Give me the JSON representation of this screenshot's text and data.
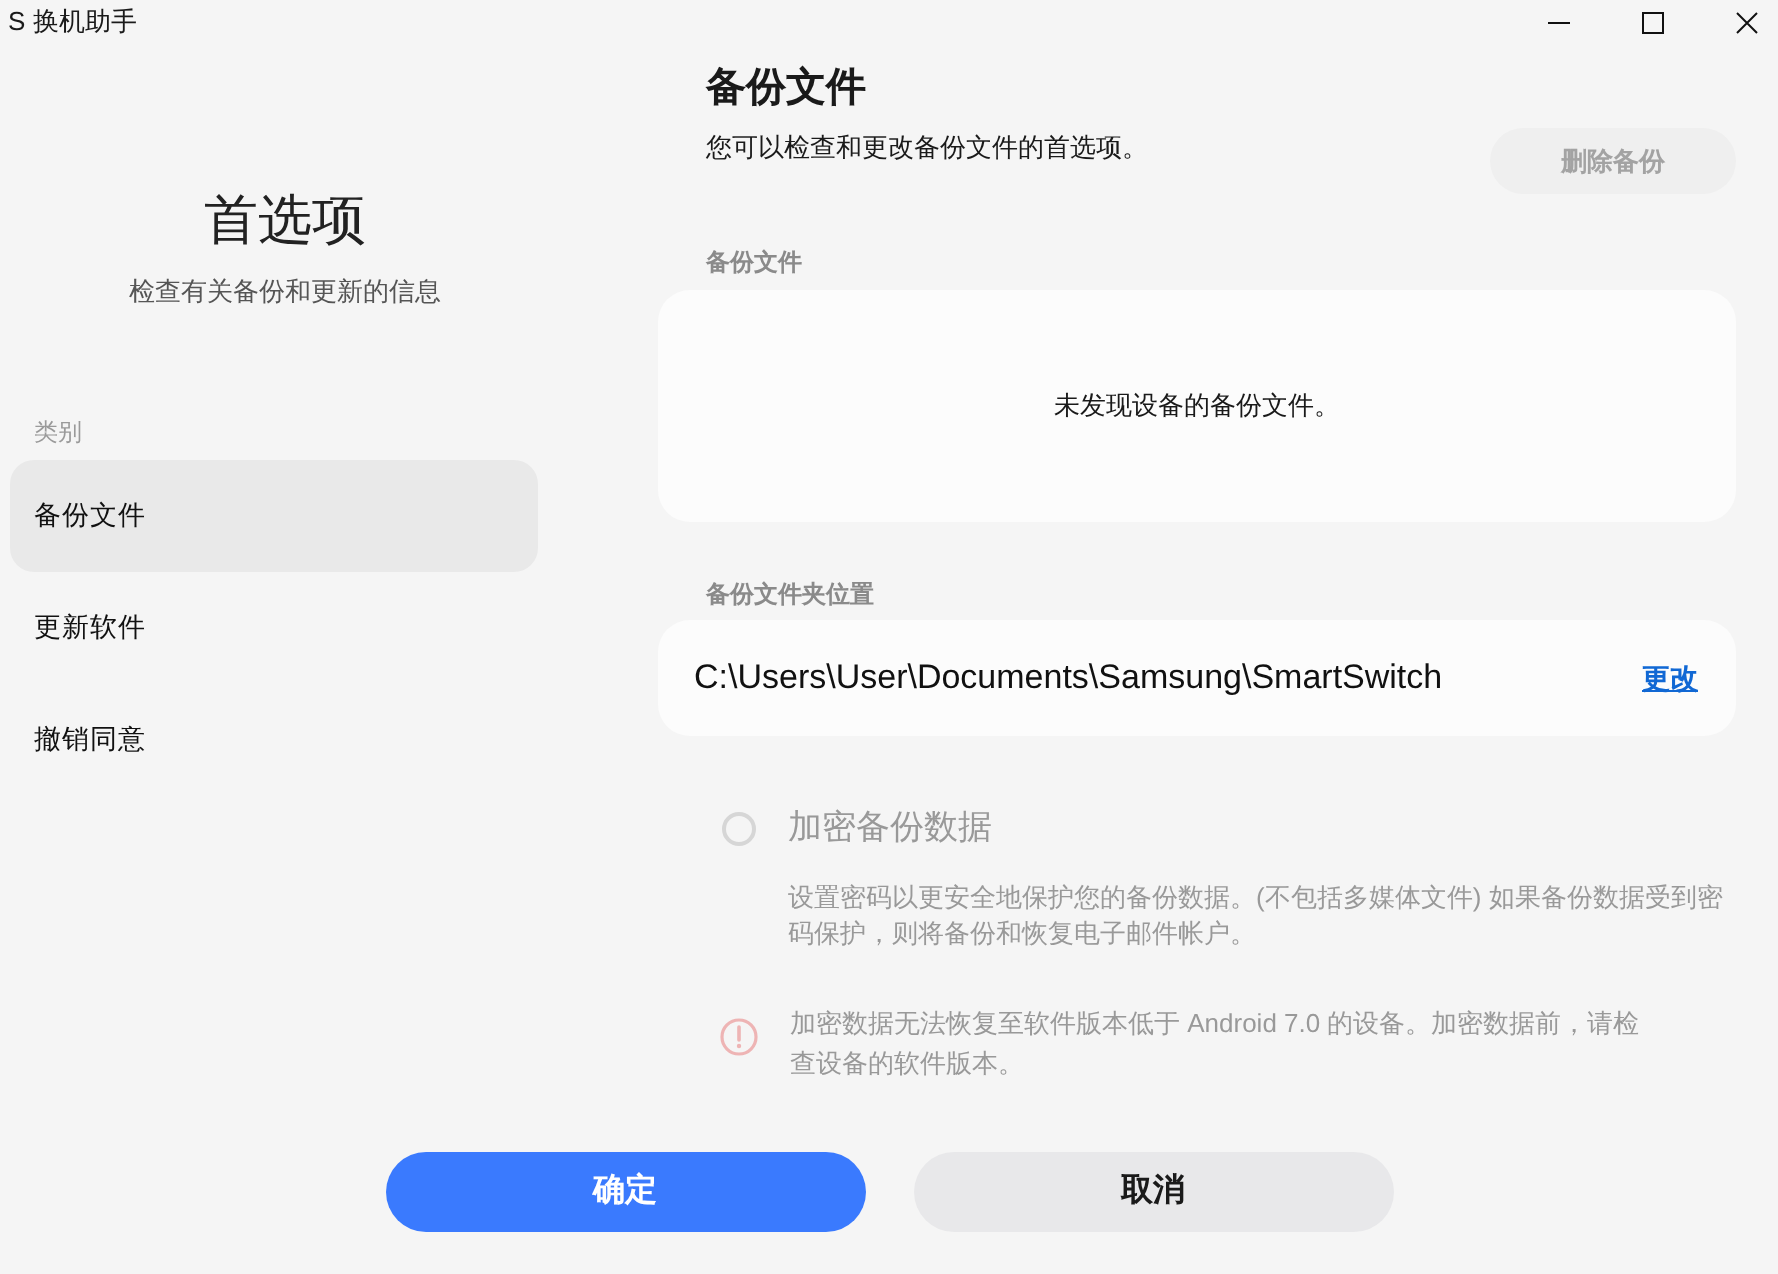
{
  "window": {
    "title": "S 换机助手"
  },
  "sidebar": {
    "title": "首选项",
    "subtitle": "检查有关备份和更新的信息",
    "category_label": "类别",
    "items": [
      {
        "label": "备份文件",
        "selected": true
      },
      {
        "label": "更新软件",
        "selected": false
      },
      {
        "label": "撤销同意",
        "selected": false
      }
    ]
  },
  "content": {
    "title": "备份文件",
    "description": "您可以检查和更改备份文件的首选项。",
    "delete_button": {
      "label": "删除备份",
      "disabled": true
    },
    "backup_files": {
      "label": "备份文件",
      "empty_message": "未发现设备的备份文件。"
    },
    "folder_location": {
      "label": "备份文件夹位置",
      "path": "C:\\Users\\User\\Documents\\Samsung\\SmartSwitch",
      "link": "更改"
    }
  },
  "encrypt": {
    "label": "加密备份数据",
    "checked": false,
    "disabled": true,
    "description": "设置密码以更安全地保护您的备份数据。(不包括多媒体文件) 如果备份数据受到密码保护，则将备份和恢复电子邮件帐户。",
    "warning": "加密数据无法恢复至软件版本低于 Android 7.0 的设备。加密数据前，请检查设备的软件版本。"
  },
  "buttons": [
    {
      "label": "确定",
      "kind": "primary"
    },
    {
      "label": "取消",
      "kind": "secondary"
    }
  ]
}
